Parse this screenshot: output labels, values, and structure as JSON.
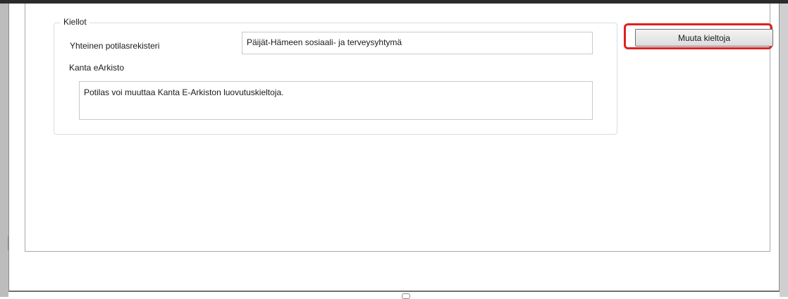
{
  "restrictions": {
    "group_title": "Kiellot",
    "shared_registry": {
      "label": "Yhteinen potilasrekisteri",
      "value": "Päijät-Hämeen sosiaali- ja terveysyhtymä"
    },
    "kanta_earchive": {
      "label": "Kanta eArkisto",
      "value": "Potilas voi muuttaa Kanta E-Arkiston luovutuskieltoja."
    },
    "change_button_label": "Muuta kieltoja",
    "highlight_color": "#e02020"
  }
}
